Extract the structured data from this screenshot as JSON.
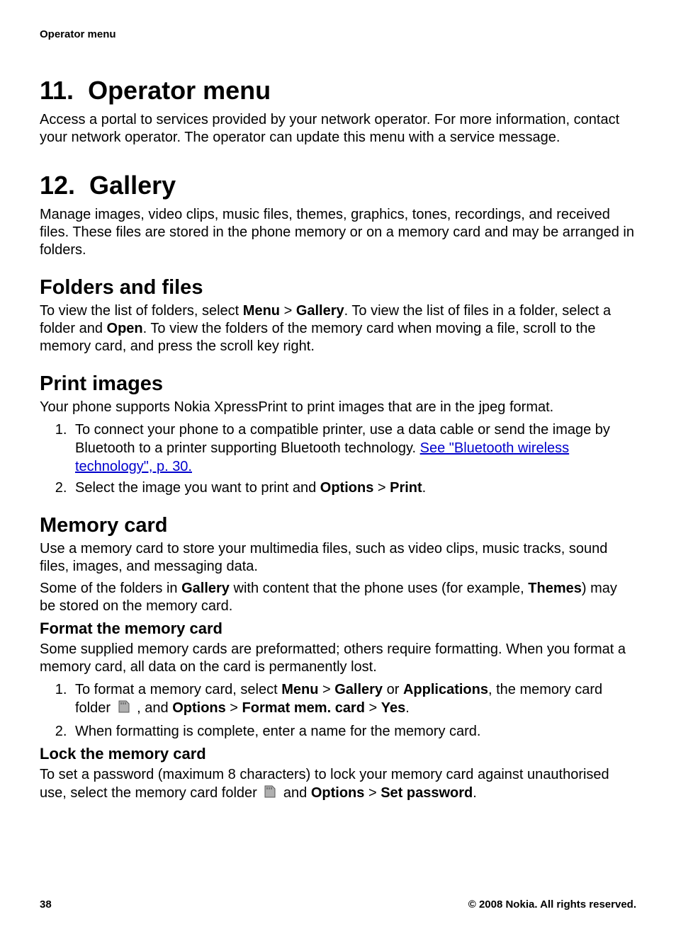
{
  "header": {
    "running": "Operator menu"
  },
  "sections": {
    "s11": {
      "number": "11.",
      "title": "Operator menu",
      "p1": "Access a portal to services provided by your network operator. For more information, contact your network operator. The operator can update this menu with a service message."
    },
    "s12": {
      "number": "12.",
      "title": "Gallery",
      "p1": "Manage images, video clips, music files, themes, graphics, tones, recordings, and received files. These files are stored in the phone memory or on a memory card and may be arranged in folders."
    },
    "folders": {
      "title": "Folders and files",
      "p1a": "To view the list of folders, select ",
      "menu": "Menu",
      "gt1": " > ",
      "gallery": "Gallery",
      "p1b": ". To view the list of files in a folder, select a folder and ",
      "open": "Open",
      "p1c": ". To view the folders of the memory card when moving a file, scroll to the memory card, and press the scroll key right."
    },
    "print": {
      "title": "Print images",
      "p1": "Your phone supports Nokia XpressPrint to print images that are in the jpeg format.",
      "li1a": "To connect your phone to a compatible printer, use a data cable or send the image by Bluetooth to a printer supporting Bluetooth technology. ",
      "link": "See \"Bluetooth wireless technology\", p. 30.",
      "li2a": "Select the image you want to print and ",
      "options": "Options",
      "gt": " > ",
      "printb": "Print",
      "li2c": "."
    },
    "memcard": {
      "title": "Memory card",
      "p1": "Use a memory card to store your multimedia files, such as video clips, music tracks, sound files, images, and messaging data.",
      "p2a": "Some of the folders in ",
      "gallery": "Gallery",
      "p2b": " with content that the phone uses (for example, ",
      "themes": "Themes",
      "p2c": ") may be stored on the memory card.",
      "format": {
        "title": "Format the memory card",
        "p1": "Some supplied memory cards are preformatted; others require formatting. When you format a memory card, all data on the card is permanently lost.",
        "li1a": "To format a memory card, select ",
        "menu": "Menu",
        "gt": " > ",
        "gallery": "Gallery",
        "or": " or ",
        "apps": "Applications",
        "li1b": ", the memory card folder ",
        "li1c": " , and ",
        "options": "Options",
        "fmc": "Format mem. card",
        "yes": "Yes",
        "li1d": ".",
        "li2": "When formatting is complete, enter a name for the memory card."
      },
      "lock": {
        "title": "Lock the memory card",
        "p1a": "To set a password (maximum 8 characters) to lock your memory card against unauthorised use, select the memory card folder ",
        "p1b": " and ",
        "options": "Options",
        "gt": " > ",
        "setpw": "Set password",
        "p1c": "."
      }
    }
  },
  "footer": {
    "page": "38",
    "copyright": "© 2008 Nokia. All rights reserved."
  }
}
